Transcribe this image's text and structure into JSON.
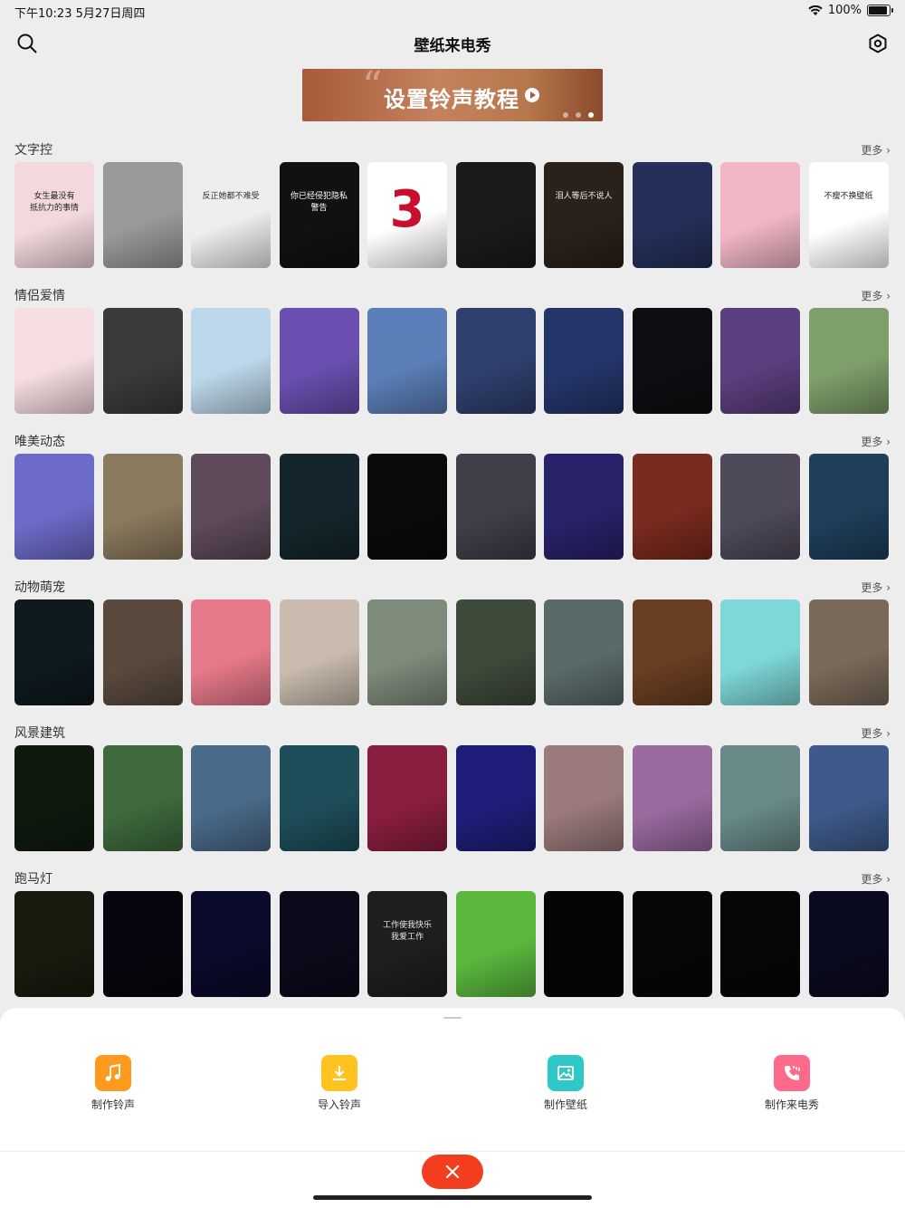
{
  "status": {
    "time": "下午10:23  5月27日周四",
    "battery": "100%",
    "battery_level": 1.0
  },
  "nav": {
    "title": "壁纸来电秀",
    "search_icon": "search-icon",
    "settings_icon": "hexagon-settings-icon"
  },
  "banner": {
    "text": "设置铃声教程",
    "pages": 3,
    "active_page": 3
  },
  "more_label": "更多",
  "sections": [
    {
      "title": "文字控",
      "cards": [
        {
          "bg": "#f3d9dd",
          "text": "女生最没有\n抵抗力的事情",
          "fg": "#222"
        },
        {
          "bg": "#9a9a9a",
          "text": "",
          "fg": "#fff"
        },
        {
          "bg": "#eeeeee",
          "text": "反正她都不难受",
          "fg": "#333"
        },
        {
          "bg": "#111111",
          "text": "你已经侵犯隐私\n警告",
          "fg": "#fff"
        },
        {
          "bg": "#ffffff",
          "text": "3",
          "fg": "#c8102e"
        },
        {
          "bg": "#1a1a1a",
          "text": "",
          "fg": "#fff"
        },
        {
          "bg": "#2a211a",
          "text": "泪人等后不说人",
          "fg": "#eee"
        },
        {
          "bg": "#24305a",
          "text": "",
          "fg": "#fff"
        },
        {
          "bg": "#f2b7c6",
          "text": "",
          "fg": "#fff"
        },
        {
          "bg": "#ffffff",
          "text": "不瘦不换壁纸",
          "fg": "#222"
        }
      ]
    },
    {
      "title": "情侣爱情",
      "cards": [
        {
          "bg": "#f6dde1",
          "text": "",
          "fg": "#fff"
        },
        {
          "bg": "#3a3a3a",
          "text": "",
          "fg": "#fff"
        },
        {
          "bg": "#bcd7ea",
          "text": "",
          "fg": "#fff"
        },
        {
          "bg": "#6a4fb0",
          "text": "",
          "fg": "#fff"
        },
        {
          "bg": "#5b7fb8",
          "text": "",
          "fg": "#fff"
        },
        {
          "bg": "#2f3f6e",
          "text": "",
          "fg": "#fff"
        },
        {
          "bg": "#24356a",
          "text": "",
          "fg": "#fff"
        },
        {
          "bg": "#0e0e12",
          "text": "",
          "fg": "#fff"
        },
        {
          "bg": "#5b3e7e",
          "text": "",
          "fg": "#fff"
        },
        {
          "bg": "#7e9e6a",
          "text": "",
          "fg": "#fff"
        }
      ]
    },
    {
      "title": "唯美动态",
      "cards": [
        {
          "bg": "#6d6bc9",
          "text": "",
          "fg": "#fff"
        },
        {
          "bg": "#8a7a5e",
          "text": "",
          "fg": "#fff"
        },
        {
          "bg": "#5e4a5a",
          "text": "",
          "fg": "#fff"
        },
        {
          "bg": "#14262c",
          "text": "",
          "fg": "#fff"
        },
        {
          "bg": "#0a0a0a",
          "text": "",
          "fg": "#fff"
        },
        {
          "bg": "#3e3f48",
          "text": "",
          "fg": "#fff"
        },
        {
          "bg": "#28226a",
          "text": "",
          "fg": "#fff"
        },
        {
          "bg": "#7a2a1e",
          "text": "",
          "fg": "#fff"
        },
        {
          "bg": "#4e4a5a",
          "text": "",
          "fg": "#fff"
        },
        {
          "bg": "#1e3e5a",
          "text": "",
          "fg": "#fff"
        }
      ]
    },
    {
      "title": "动物萌宠",
      "cards": [
        {
          "bg": "#0e1a1e",
          "text": "",
          "fg": "#fff"
        },
        {
          "bg": "#5a4a3e",
          "text": "",
          "fg": "#fff"
        },
        {
          "bg": "#e8798a",
          "text": "",
          "fg": "#fff"
        },
        {
          "bg": "#c9bcae",
          "text": "",
          "fg": "#fff"
        },
        {
          "bg": "#7e8a7a",
          "text": "",
          "fg": "#fff"
        },
        {
          "bg": "#3e4a3a",
          "text": "",
          "fg": "#fff"
        },
        {
          "bg": "#5a6a6a",
          "text": "",
          "fg": "#fff"
        },
        {
          "bg": "#6a3e22",
          "text": "",
          "fg": "#fff"
        },
        {
          "bg": "#7fd8d8",
          "text": "",
          "fg": "#fff"
        },
        {
          "bg": "#7a6a5a",
          "text": "",
          "fg": "#fff"
        }
      ]
    },
    {
      "title": "风景建筑",
      "cards": [
        {
          "bg": "#0e1a0e",
          "text": "",
          "fg": "#fff"
        },
        {
          "bg": "#3e6a3e",
          "text": "",
          "fg": "#fff"
        },
        {
          "bg": "#4a6a8a",
          "text": "",
          "fg": "#fff"
        },
        {
          "bg": "#1e4e5a",
          "text": "",
          "fg": "#fff"
        },
        {
          "bg": "#8a1e3e",
          "text": "",
          "fg": "#fff"
        },
        {
          "bg": "#1e1e7a",
          "text": "",
          "fg": "#fff"
        },
        {
          "bg": "#9a7a7a",
          "text": "",
          "fg": "#fff"
        },
        {
          "bg": "#9a6aa0",
          "text": "",
          "fg": "#fff"
        },
        {
          "bg": "#6a8a8a",
          "text": "",
          "fg": "#fff"
        },
        {
          "bg": "#3e5a8a",
          "text": "",
          "fg": "#fff"
        }
      ]
    },
    {
      "title": "跑马灯",
      "cards": [
        {
          "bg": "#1a1a0e",
          "text": "",
          "fg": "#fff"
        },
        {
          "bg": "#06060e",
          "text": "",
          "fg": "#fff"
        },
        {
          "bg": "#0a0a2a",
          "text": "",
          "fg": "#fff"
        },
        {
          "bg": "#0a0a1a",
          "text": "",
          "fg": "#fff"
        },
        {
          "bg": "#1e1e1e",
          "text": "工作使我快乐\n我爱工作",
          "fg": "#e8e8e8"
        },
        {
          "bg": "#5ab83e",
          "text": "",
          "fg": "#fff"
        },
        {
          "bg": "#050505",
          "text": "",
          "fg": "#fff"
        },
        {
          "bg": "#060608",
          "text": "",
          "fg": "#fff"
        },
        {
          "bg": "#060608",
          "text": "",
          "fg": "#fff"
        },
        {
          "bg": "#0a0a1e",
          "text": "",
          "fg": "#fff"
        }
      ]
    }
  ],
  "sheet": {
    "actions": [
      {
        "label": "制作铃声",
        "icon": "music-note-icon",
        "color": "#ff9a1e"
      },
      {
        "label": "导入铃声",
        "icon": "download-icon",
        "color": "#ffc21e"
      },
      {
        "label": "制作壁纸",
        "icon": "image-icon",
        "color": "#2fc8c8"
      },
      {
        "label": "制作来电秀",
        "icon": "phone-call-icon",
        "color": "#ff6a8a"
      }
    ],
    "close_icon": "close-icon"
  }
}
